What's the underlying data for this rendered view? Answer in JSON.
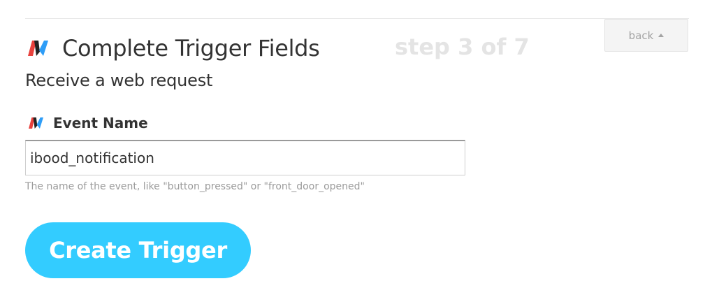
{
  "header": {
    "title": "Complete Trigger Fields",
    "step": "step 3 of 7",
    "subtitle": "Receive a web request",
    "logo_icon": "maker-webhooks-logo-icon"
  },
  "back_button": {
    "label": "back",
    "icon": "caret-up-icon"
  },
  "form": {
    "field_label": "Event Name",
    "field_icon": "maker-webhooks-logo-icon",
    "event_name_value": "ibood_notification",
    "help_text": "The name of the event, like \"button_pressed\" or \"front_door_opened\""
  },
  "submit": {
    "label": "Create Trigger"
  },
  "colors": {
    "accent": "#33ccff",
    "logo_red": "#e8413d",
    "logo_blue": "#2e9df7",
    "logo_dark": "#222222",
    "step_text": "#e4e4e4",
    "help_text": "#9b9b9b"
  }
}
